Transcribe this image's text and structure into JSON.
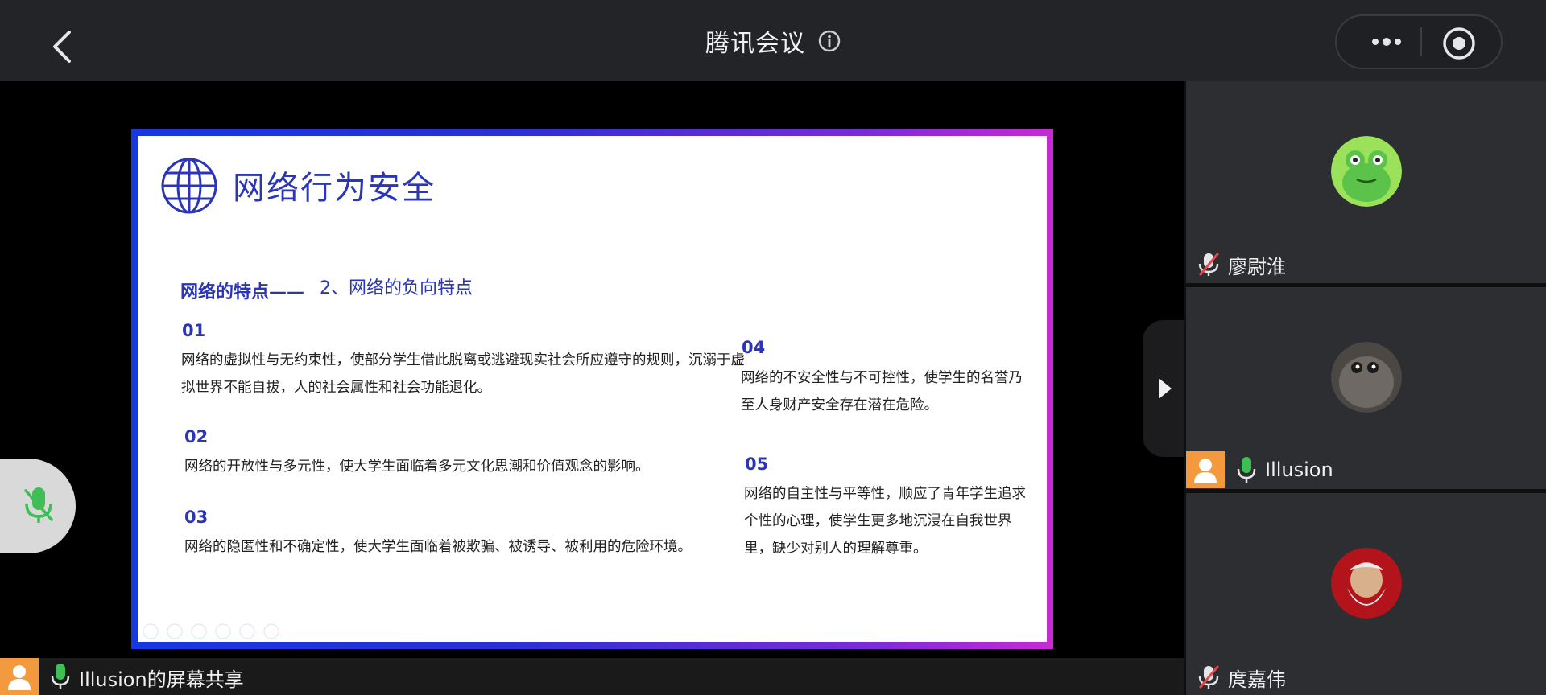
{
  "header": {
    "title": "腾讯会议",
    "icons": {
      "back": "chevron-left-icon",
      "info": "info-icon",
      "more": "more-dots-icon",
      "record": "record-icon"
    }
  },
  "slide": {
    "title": "网络行为安全",
    "subtitle_bold": "网络的特点——",
    "subtitle_rest": "2、网络的负向特点",
    "points": [
      {
        "num": "01",
        "text": "网络的虚拟性与无约束性，使部分学生借此脱离或逃避现实社会所应遵守的规则，沉溺于虚拟世界不能自拔，人的社会属性和社会功能退化。"
      },
      {
        "num": "02",
        "text": "网络的开放性与多元性，使大学生面临着多元文化思潮和价值观念的影响。"
      },
      {
        "num": "03",
        "text": "网络的隐匿性和不确定性，使大学生面临着被欺骗、被诱导、被利用的危险环境。"
      },
      {
        "num": "04",
        "text": "网络的不安全性与不可控性，使学生的名誉乃至人身财产安全存在潜在危险。"
      },
      {
        "num": "05",
        "text": "网络的自主性与平等性，顺应了青年学生追求个性的心理，使学生更多地沉浸在自我世界里，缺少对别人的理解尊重。"
      }
    ]
  },
  "share_bar": {
    "label": "Illusion的屏幕共享"
  },
  "participants": [
    {
      "name": "廖尉淮",
      "mic": "muted",
      "avatar": "frog-avatar"
    },
    {
      "name": "Illusion",
      "mic": "on",
      "avatar": "cat-avatar"
    },
    {
      "name": "庹嘉伟",
      "mic": "muted",
      "avatar": "old-man-avatar"
    }
  ],
  "colors": {
    "accent_orange": "#f39a3f",
    "mic_green": "#3dbf56",
    "muted_red": "#e5484d",
    "slide_blue": "#2a35b8"
  }
}
